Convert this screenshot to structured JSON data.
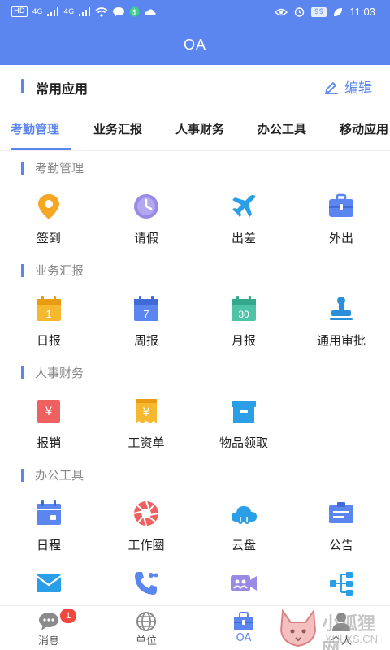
{
  "status_bar": {
    "carrier_badge": "HD",
    "net_1": "4G",
    "net_2": "4G",
    "battery": "99",
    "time": "11:03"
  },
  "header": {
    "title": "OA"
  },
  "common": {
    "title": "常用应用",
    "edit_label": "编辑"
  },
  "tabs": [
    {
      "label": "考勤管理",
      "active": true
    },
    {
      "label": "业务汇报"
    },
    {
      "label": "人事财务"
    },
    {
      "label": "办公工具"
    },
    {
      "label": "移动应用"
    }
  ],
  "sections": [
    {
      "title": "考勤管理",
      "items": [
        {
          "label": "签到",
          "icon": "location-pin-icon"
        },
        {
          "label": "请假",
          "icon": "clock-icon"
        },
        {
          "label": "出差",
          "icon": "airplane-icon"
        },
        {
          "label": "外出",
          "icon": "briefcase-icon"
        }
      ]
    },
    {
      "title": "业务汇报",
      "items": [
        {
          "label": "日报",
          "icon": "calendar-1-icon",
          "icon_text": "1"
        },
        {
          "label": "周报",
          "icon": "calendar-7-icon",
          "icon_text": "7"
        },
        {
          "label": "月报",
          "icon": "calendar-30-icon",
          "icon_text": "30"
        },
        {
          "label": "通用审批",
          "icon": "stamp-icon"
        }
      ]
    },
    {
      "title": "人事财务",
      "items": [
        {
          "label": "报销",
          "icon": "reimburse-icon",
          "icon_text": "¥"
        },
        {
          "label": "工资单",
          "icon": "payslip-icon",
          "icon_text": "¥"
        },
        {
          "label": "物品领取",
          "icon": "box-icon"
        }
      ]
    },
    {
      "title": "办公工具",
      "items": [
        {
          "label": "日程",
          "icon": "schedule-icon"
        },
        {
          "label": "工作圈",
          "icon": "aperture-icon"
        },
        {
          "label": "云盘",
          "icon": "cloud-icon"
        },
        {
          "label": "公告",
          "icon": "notice-icon"
        }
      ]
    }
  ],
  "partial_row": [
    {
      "icon": "mail-icon"
    },
    {
      "icon": "phone-contacts-icon"
    },
    {
      "icon": "video-meeting-icon"
    },
    {
      "icon": "org-chart-icon"
    }
  ],
  "bottom_nav": [
    {
      "label": "消息",
      "icon": "chat-icon",
      "badge": "1"
    },
    {
      "label": "单位",
      "icon": "globe-icon"
    },
    {
      "label": "OA",
      "icon": "oa-briefcase-icon",
      "active": true
    },
    {
      "label": "个人",
      "icon": "person-icon"
    }
  ],
  "watermark": {
    "text": "小狐狸网",
    "sub": "XHLXS.CN"
  },
  "colors": {
    "primary": "#5b86f0",
    "orange": "#f5a623",
    "purple": "#9a8ae6",
    "red": "#ef5a5a",
    "teal": "#4fc3a8",
    "badge": "#f0483e"
  }
}
